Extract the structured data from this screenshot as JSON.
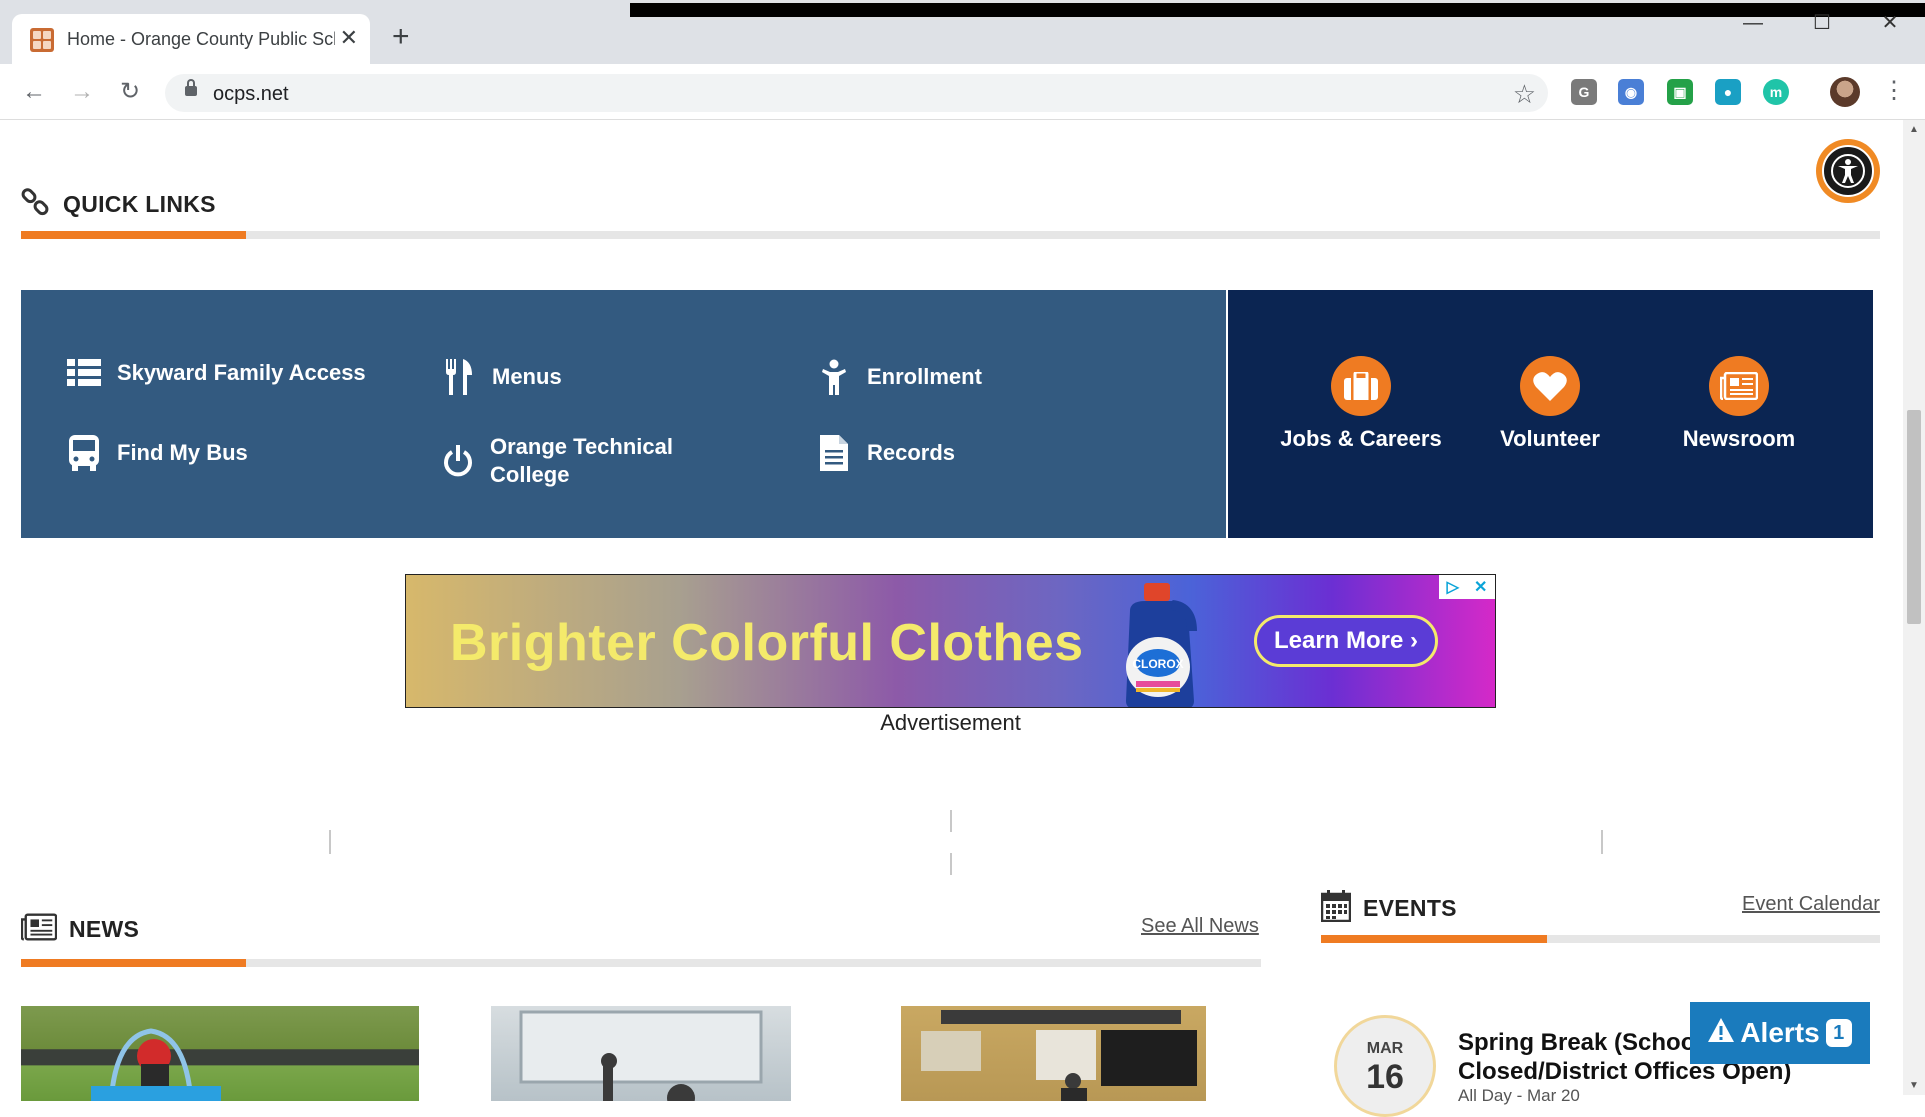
{
  "browser": {
    "tab_title": "Home - Orange County Public Schools",
    "new_tab_symbol": "+",
    "close_tab_symbol": "✕",
    "url": "ocps.net",
    "window_controls": [
      "—",
      "☐",
      "✕"
    ],
    "extensions": [
      {
        "name": "grammarly-ext-icon",
        "label": "G",
        "color": "#7a7a7a"
      },
      {
        "name": "camera-ext-icon",
        "label": "◉",
        "color": "#4a7fd6"
      },
      {
        "name": "screen-ext-icon",
        "label": "▣",
        "color": "#24a148"
      },
      {
        "name": "globe-ext-icon",
        "label": "●",
        "color": "#1aa0c4"
      },
      {
        "name": "mote-ext-icon",
        "label": "m",
        "color": "#20c4a8"
      }
    ]
  },
  "quick_links": {
    "title": "QUICK LINKS",
    "items": [
      {
        "label": "Skyward Family Access",
        "icon": "list-icon"
      },
      {
        "label": "Menus",
        "icon": "utensils-icon"
      },
      {
        "label": "Enrollment",
        "icon": "child-icon"
      },
      {
        "label": "Find My Bus",
        "icon": "bus-icon"
      },
      {
        "label": "Orange Technical College",
        "icon": "power-icon"
      },
      {
        "label": "Records",
        "icon": "document-icon"
      }
    ],
    "featured": [
      {
        "label": "Jobs & Careers",
        "icon": "briefcase-icon"
      },
      {
        "label": "Volunteer",
        "icon": "heart-icon"
      },
      {
        "label": "Newsroom",
        "icon": "newspaper-icon"
      }
    ]
  },
  "ad": {
    "headline": "Brighter Colorful Clothes",
    "cta": "Learn More ›",
    "brand": "CLOROX",
    "label": "Advertisement"
  },
  "news": {
    "title": "NEWS",
    "see_all": "See All News"
  },
  "events": {
    "title": "EVENTS",
    "calendar_link": "Event Calendar",
    "items": [
      {
        "month": "MAR",
        "day": "16",
        "title": "Spring Break (Schools Closed/District Offices Open)",
        "time": "All Day - Mar 20"
      }
    ]
  },
  "alerts": {
    "label": "Alerts",
    "count": "1"
  },
  "colors": {
    "accent": "#ef7b22",
    "panel_blue": "#335a80",
    "panel_navy": "#0b2552",
    "alerts_blue": "#1a7bbd"
  }
}
